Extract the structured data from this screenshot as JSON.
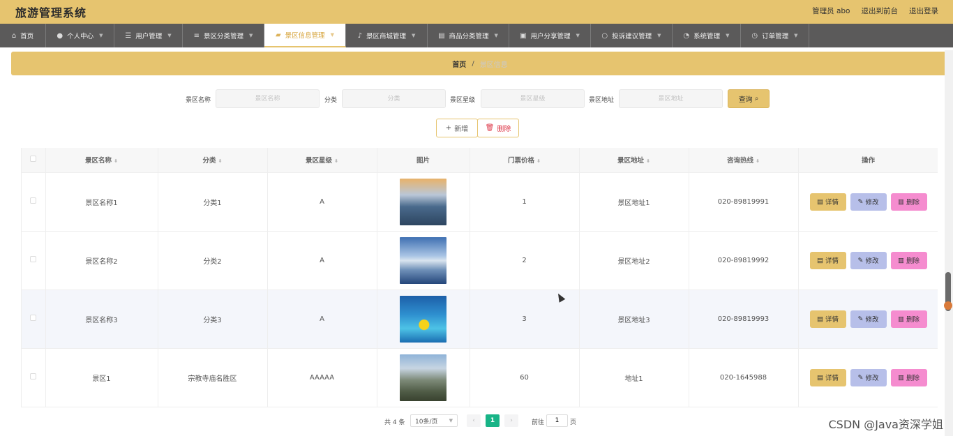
{
  "header": {
    "title": "旅游管理系统",
    "user": "管理员 abo",
    "to_front": "退出到前台",
    "logout": "退出登录"
  },
  "nav": [
    {
      "label": "首页",
      "icon": "home-icon"
    },
    {
      "label": "个人中心",
      "icon": "user-icon"
    },
    {
      "label": "用户管理",
      "icon": "list-icon"
    },
    {
      "label": "景区分类管理",
      "icon": "sliders-icon"
    },
    {
      "label": "景区信息管理",
      "icon": "folder-icon",
      "active": true
    },
    {
      "label": "景区商城管理",
      "icon": "mic-icon"
    },
    {
      "label": "商品分类管理",
      "icon": "doc-icon"
    },
    {
      "label": "用户分享管理",
      "icon": "briefcase-icon"
    },
    {
      "label": "投诉建议管理",
      "icon": "circle-icon"
    },
    {
      "label": "系统管理",
      "icon": "gauge-icon"
    },
    {
      "label": "订单管理",
      "icon": "clock-icon"
    }
  ],
  "breadcrumb": {
    "home": "首页",
    "sep": "/",
    "current": "景区信息"
  },
  "search": {
    "name_label": "景区名称",
    "name_placeholder": "景区名称",
    "cat_label": "分类",
    "cat_placeholder": "分类",
    "level_label": "景区星级",
    "level_placeholder": "景区星级",
    "addr_label": "景区地址",
    "addr_placeholder": "景区地址",
    "query": "查询"
  },
  "actions": {
    "add": "新增",
    "delete": "删除"
  },
  "table": {
    "headers": [
      "景区名称",
      "分类",
      "景区星级",
      "图片",
      "门票价格",
      "景区地址",
      "咨询热线",
      "操作"
    ],
    "rows": [
      {
        "name": "景区名称1",
        "cat": "分类1",
        "level": "A",
        "price": "1",
        "addr": "景区地址1",
        "phone": "020-89819991"
      },
      {
        "name": "景区名称2",
        "cat": "分类2",
        "level": "A",
        "price": "2",
        "addr": "景区地址2",
        "phone": "020-89819992"
      },
      {
        "name": "景区名称3",
        "cat": "分类3",
        "level": "A",
        "price": "3",
        "addr": "景区地址3",
        "phone": "020-89819993"
      },
      {
        "name": "景区1",
        "cat": "宗教寺庙名胜区",
        "level": "AAAAA",
        "price": "60",
        "addr": "地址1",
        "phone": "020-1645988"
      }
    ],
    "op_detail": "详情",
    "op_edit": "修改",
    "op_delete": "删除"
  },
  "pager": {
    "total": "共 4 条",
    "size": "10条/页",
    "current": "1",
    "goto": "前往",
    "page_input": "1",
    "unit": "页"
  },
  "watermark": "CSDN @Java资深学姐"
}
